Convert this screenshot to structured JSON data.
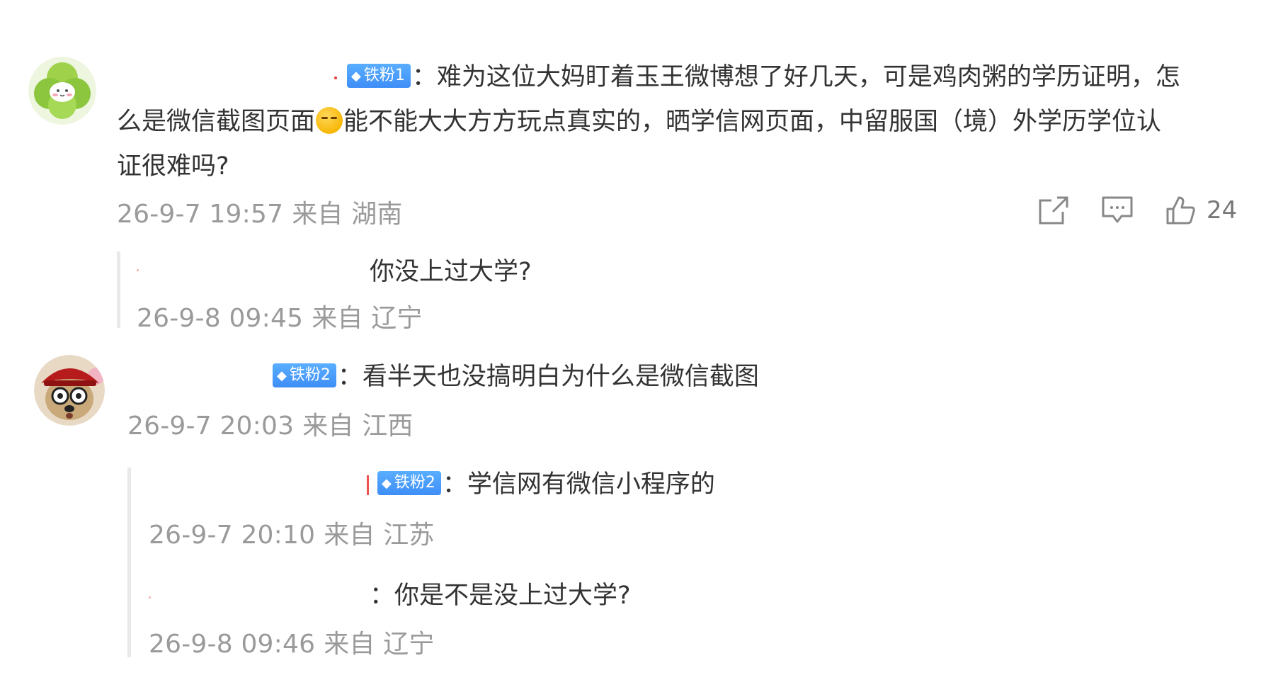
{
  "comment1": {
    "badge_label": "铁粉1",
    "text_line1": "：难为这位大妈盯着玉王微博想了好几天，可是鸡肉粥的学历证明，怎",
    "text_line2a": "么是微信截图页面",
    "emoji_icon": "unamused-face-emoji",
    "text_line2b": "能不能大大方方玩点真实的，晒学信网页面，中留服国（境）外学历学位认",
    "text_line3": "证很难吗?",
    "time": "26-9-7 19:57",
    "location": "来自 湖南",
    "like_count": "24"
  },
  "reply1": {
    "text": "你没上过大学?",
    "time": "26-9-8 09:45",
    "location": "来自 辽宁"
  },
  "comment2": {
    "badge_label": "铁粉2",
    "text": "：看半天也没搞明白为什么是微信截图",
    "time": "26-9-7 20:03",
    "location": "来自 江西"
  },
  "reply2": {
    "badge_label": "铁粉2",
    "text": "：学信网有微信小程序的",
    "time": "26-9-7 20:10",
    "location": "来自 江苏"
  },
  "reply3": {
    "text": "：你是不是没上过大学?",
    "time": "26-9-8 09:46",
    "location": "来自 辽宁"
  }
}
